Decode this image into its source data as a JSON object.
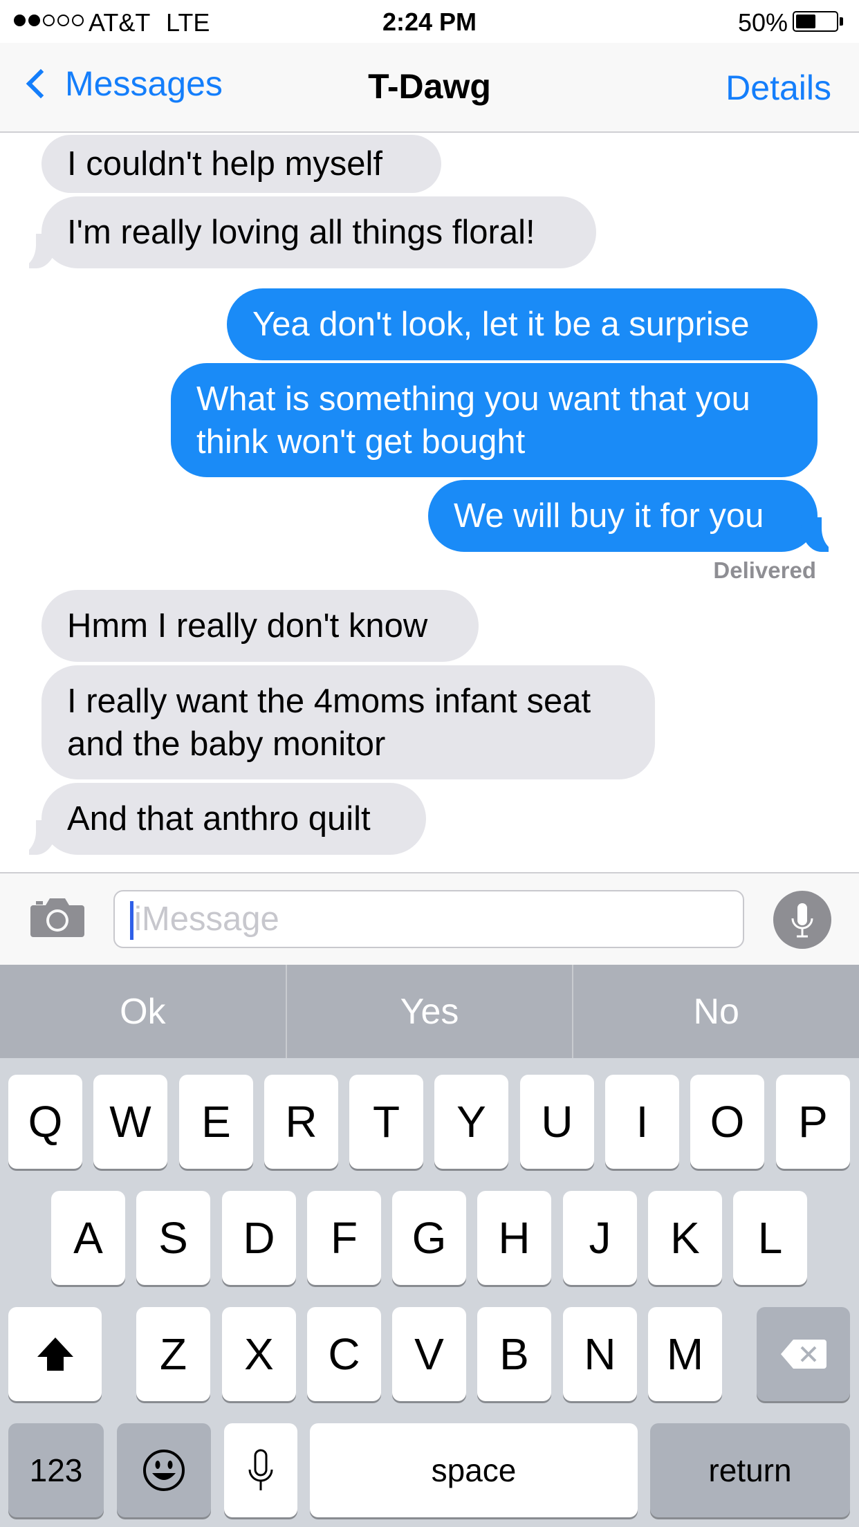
{
  "status_bar": {
    "carrier": "AT&T",
    "network": "LTE",
    "time": "2:24 PM",
    "battery_percent": "50%",
    "battery_level": 0.5,
    "signal_bars_filled": 2,
    "signal_bars_total": 5
  },
  "nav": {
    "back_label": "Messages",
    "title": "T-Dawg",
    "details_label": "Details"
  },
  "messages": [
    {
      "direction": "received",
      "text": "I couldn't help myself"
    },
    {
      "direction": "received",
      "text": "I'm really loving all things floral!"
    },
    {
      "direction": "sent",
      "text": "Yea don't look, let it be a surprise"
    },
    {
      "direction": "sent",
      "text": "What is something you want that you\nthink won't get bought"
    },
    {
      "direction": "sent",
      "text": "We will buy it for you"
    },
    {
      "direction": "received",
      "text": "Hmm I really don't know"
    },
    {
      "direction": "received",
      "text": "I really want the 4moms infant seat\nand the baby monitor"
    },
    {
      "direction": "received",
      "text": "And that anthro quilt"
    }
  ],
  "delivery_status": "Delivered",
  "input": {
    "placeholder": "iMessage",
    "value": ""
  },
  "suggestions": [
    "Ok",
    "Yes",
    "No"
  ],
  "keyboard": {
    "row1": [
      "Q",
      "W",
      "E",
      "R",
      "T",
      "Y",
      "U",
      "I",
      "O",
      "P"
    ],
    "row2": [
      "A",
      "S",
      "D",
      "F",
      "G",
      "H",
      "J",
      "K",
      "L"
    ],
    "row3": [
      "Z",
      "X",
      "C",
      "V",
      "B",
      "N",
      "M"
    ],
    "numbers_label": "123",
    "space_label": "space",
    "return_label": "return"
  },
  "colors": {
    "accent": "#147efb",
    "sent_bubble": "#1a8bf7",
    "received_bubble": "#e5e5ea",
    "keyboard_bg": "#d1d5db",
    "suggestion_bar": "#adb1b9"
  },
  "icons": {
    "back": "chevron-left-icon",
    "camera": "camera-icon",
    "mic": "microphone-icon",
    "shift": "shift-arrow-icon",
    "delete": "delete-backspace-icon",
    "emoji": "emoji-smiley-icon",
    "dictation": "microphone-icon"
  }
}
